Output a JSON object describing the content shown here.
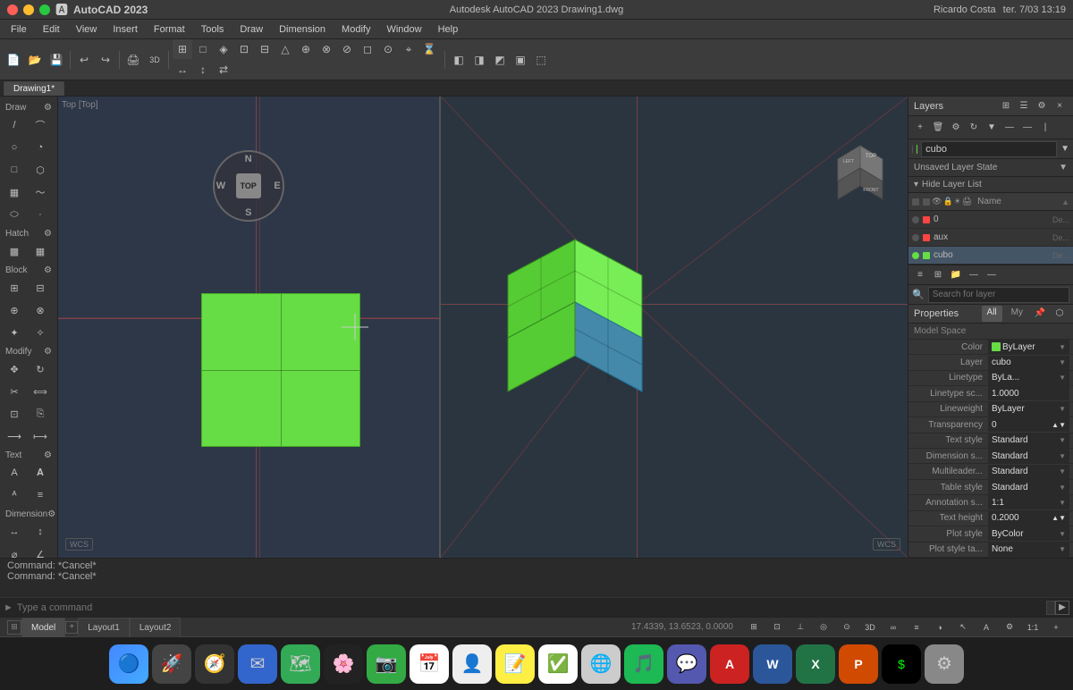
{
  "app": {
    "name": "AutoCAD 2023",
    "title": "Autodesk AutoCAD 2023  Drawing1.dwg",
    "version": "2023"
  },
  "titlebar": {
    "app_name": "AutoCAD 2023",
    "center_title": "Autodesk AutoCAD 2023  Drawing1.dwg",
    "user": "Ricardo Costa",
    "time": "ter. 7/03  13:19"
  },
  "menu": {
    "items": [
      "File",
      "Edit",
      "View",
      "Insert",
      "Format",
      "Tools",
      "Draw",
      "Dimension",
      "Modify",
      "Window",
      "Help"
    ]
  },
  "left_toolbar": {
    "sections": [
      {
        "name": "Draw",
        "icon": "▾"
      },
      {
        "name": "Hatch",
        "icon": "▾"
      },
      {
        "name": "Block",
        "icon": "▾"
      },
      {
        "name": "Modify",
        "icon": "▾"
      },
      {
        "name": "Text",
        "icon": "▾"
      },
      {
        "name": "Dimension",
        "icon": "▾"
      }
    ]
  },
  "viewport": {
    "left_label": "Top  [Top]",
    "right_label": "",
    "wcs_label": "WCS",
    "compass_top": "N",
    "compass_bottom": "S",
    "compass_east": "E",
    "compass_west": "W",
    "compass_center": "TOP"
  },
  "command": {
    "line1": "Command: *Cancel*",
    "line2": "Command: *Cancel*",
    "prompt_label": "►",
    "placeholder": "Type a command"
  },
  "tabs": {
    "model": "Model",
    "layout1": "Layout1",
    "layout2": "Layout2"
  },
  "statusbar": {
    "coords": "17.4339, 13.6523, 0.0000"
  },
  "layers": {
    "panel_title": "Layers",
    "current_layer": "cubo",
    "state_label": "Unsaved Layer State",
    "hide_label": "Hide Layer List",
    "search_placeholder": "Search for layer",
    "headers": [
      "Name"
    ],
    "rows": [
      {
        "name": "0",
        "color": "#ff4444",
        "desc": "De..."
      },
      {
        "name": "aux",
        "color": "#ff4444",
        "desc": "De..."
      },
      {
        "name": "cubo",
        "color": "#66dd44",
        "desc": "De..."
      }
    ]
  },
  "properties": {
    "panel_title": "Properties",
    "tabs": [
      "All",
      "My"
    ],
    "section_label": "Model Space",
    "rows": [
      {
        "label": "Color",
        "value": "ByLayer",
        "color": "#66dd44"
      },
      {
        "label": "Layer",
        "value": "cubo"
      },
      {
        "label": "Linetype",
        "value": "ByLa..."
      },
      {
        "label": "Linetype sc...",
        "value": "1.0000"
      },
      {
        "label": "Lineweight",
        "value": "ByLayer"
      },
      {
        "label": "Transparency",
        "value": "0"
      },
      {
        "label": "Text style",
        "value": "Standard"
      },
      {
        "label": "Dimension s...",
        "value": "Standard"
      },
      {
        "label": "Multileader...",
        "value": "Standard"
      },
      {
        "label": "Table style",
        "value": "Standard"
      },
      {
        "label": "Annotation s...",
        "value": "1:1"
      },
      {
        "label": "Text height",
        "value": "0.2000"
      },
      {
        "label": "Plot style",
        "value": "ByColor"
      },
      {
        "label": "Plot style ta...",
        "value": "None"
      }
    ]
  }
}
